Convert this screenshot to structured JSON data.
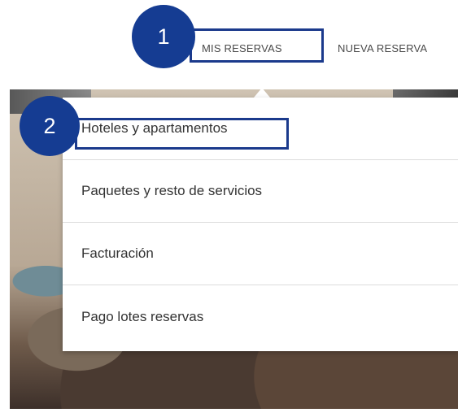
{
  "nav": {
    "items": [
      {
        "label": "MIS RESERVAS"
      },
      {
        "label": "NUEVA RESERVA"
      }
    ]
  },
  "badges": [
    "1",
    "2"
  ],
  "dropdown": {
    "items": [
      {
        "label": "Hoteles y apartamentos"
      },
      {
        "label": "Paquetes y resto de servicios"
      },
      {
        "label": "Facturación"
      },
      {
        "label": "Pago lotes reservas"
      }
    ]
  },
  "colors": {
    "badge": "#153c92",
    "highlight_border": "#1b3a8c",
    "menu_background": "#ffffff"
  }
}
